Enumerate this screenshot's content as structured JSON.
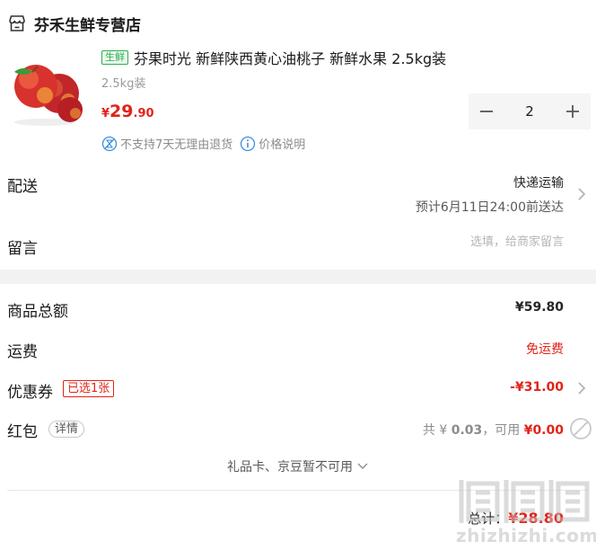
{
  "shop": {
    "name": "芬禾生鲜专营店",
    "icon": "store-icon"
  },
  "product": {
    "tag": "生鲜",
    "title": "芬果时光 新鲜陕西黄心油桃子 新鲜水果 2.5kg装",
    "spec": "2.5kg装",
    "price_symbol": "¥",
    "price_int": "29",
    "price_dec": ".90",
    "quantity": "2",
    "services": [
      "不支持7天无理由退货",
      "价格说明"
    ]
  },
  "delivery": {
    "label": "配送",
    "method": "快递运输",
    "eta": "预计6月11日24:00前送达"
  },
  "remark": {
    "label": "留言",
    "placeholder": "选填，给商家留言"
  },
  "summary": {
    "goods_total_label": "商品总额",
    "goods_total_value": "¥59.80",
    "shipping_label": "运费",
    "shipping_value": "免运费",
    "coupon_label": "优惠券",
    "coupon_badge": "已选1张",
    "coupon_value": "-¥31.00",
    "redpacket_label": "红包",
    "redpacket_detail": "详情",
    "redpacket_total_prefix": "共 ¥ ",
    "redpacket_total": "0.03",
    "redpacket_avail_prefix": "，可用 ",
    "redpacket_avail": "¥0.00",
    "unusable_note": "礼品卡、京豆暂不可用",
    "total_label": "总计：",
    "total_value": "¥28.80"
  },
  "watermark": {
    "text": "zhizhizhi.com",
    "logo": "值值值"
  },
  "colors": {
    "accent": "#e2231a",
    "fresh_green": "#2fae52",
    "service_blue": "#3d8fe0"
  }
}
